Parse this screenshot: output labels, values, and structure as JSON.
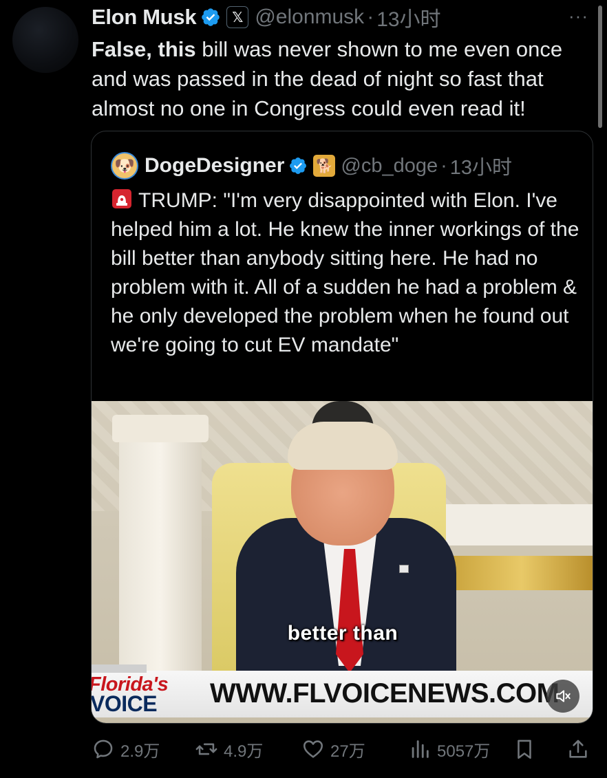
{
  "tweet": {
    "author_name": "Elon Musk",
    "handle": "@elonmusk",
    "separator": "·",
    "time": "13小时",
    "more_label": "···",
    "text_bold": "False, this",
    "text_rest": " bill was never shown to me even once and was passed in the dead of night so fast that almost no one in Congress could even read it!"
  },
  "quote": {
    "author_name": "DogeDesigner",
    "handle": "@cb_doge",
    "separator": "·",
    "time": "13小时",
    "text": "TRUMP: \"I'm very disappointed with Elon. I've helped him a lot. He knew the inner workings of the bill better than anybody sitting here. He had no problem with it. All of a sudden he had a problem & he only developed the problem when he found out we're going to cut EV mandate\"",
    "video": {
      "caption": "better than",
      "logo_top": "Florida's",
      "logo_bottom": "VOICE",
      "url": "WWW.FLVOICENEWS.COM",
      "muted": true
    }
  },
  "actions": {
    "replies": "2.9万",
    "reposts": "4.9万",
    "likes": "27万",
    "views": "5057万"
  },
  "colors": {
    "background": "#000000",
    "text": "#e7e9ea",
    "secondary": "#71767b",
    "verified": "#1d9bf0",
    "border": "#2f3336"
  }
}
